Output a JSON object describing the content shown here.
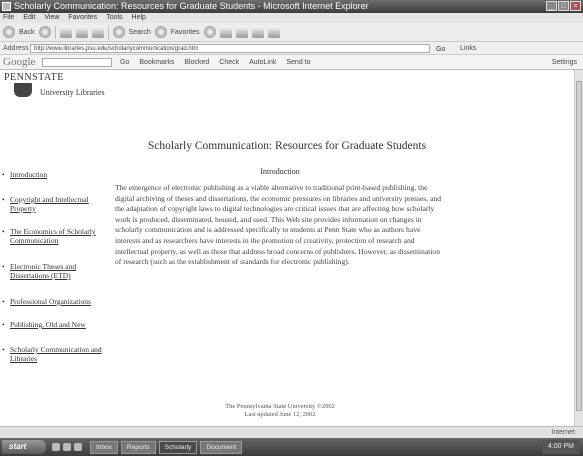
{
  "window": {
    "title": "Scholarly Communication: Resources for Graduate Students - Microsoft Internet Explorer"
  },
  "menu": [
    "File",
    "Edit",
    "View",
    "Favorites",
    "Tools",
    "Help"
  ],
  "toolbar": {
    "back": "Back",
    "search": "Search",
    "favorites": "Favorites"
  },
  "address": {
    "label": "Address",
    "value": "http://www.libraries.psu.edu/scholarlycommunication/grad.htm",
    "go": "Go",
    "links": "Links"
  },
  "google": {
    "logo": "Google",
    "items": [
      "Go",
      "Bookmarks",
      "Blocked",
      "Check",
      "AutoLink",
      "Send to"
    ],
    "settings": "Settings"
  },
  "page": {
    "logo": "PENNSTATE",
    "library": "University Libraries",
    "title": "Scholarly Communication: Resources for Graduate Students",
    "nav": [
      "Introduction",
      "Copyright and Intellectual Property",
      "The Economics of Scholarly Communication",
      "Electronic Theses and Dissertations (ETD)",
      "Professional Organizations",
      "Publishing, Old and New",
      "Scholarly Communication and Libraries"
    ],
    "section_title": "Introduction",
    "body": "The emergence of electronic publishing as a viable alternative to traditional print-based publishing, the digital archiving of theses and dissertations, the economic pressures on libraries and university presses, and the adaptation of copyright laws to digital technologies are critical issues that are affecting how scholarly work is produced, disseminated, housed, and used. This Web site provides information on changes in scholarly communication and is addressed specifically to students at Penn State who as authors have interests and as researchers have interests in the promotion of creativity, protection of research and intellectual property, as well as those that address broad concerns of publishers. However, as dissemination of research (such as the establishment of standards for electronic publishing).",
    "footer_line1": "The Pennsylvania State University ©2002",
    "footer_line2": "Last updated June 12, 2002"
  },
  "status": {
    "zone": "Internet"
  },
  "taskbar": {
    "start": "start",
    "tasks": [
      "Inbox",
      "Reports",
      "Scholarly",
      "Document"
    ],
    "clock": "4:00 PM"
  }
}
